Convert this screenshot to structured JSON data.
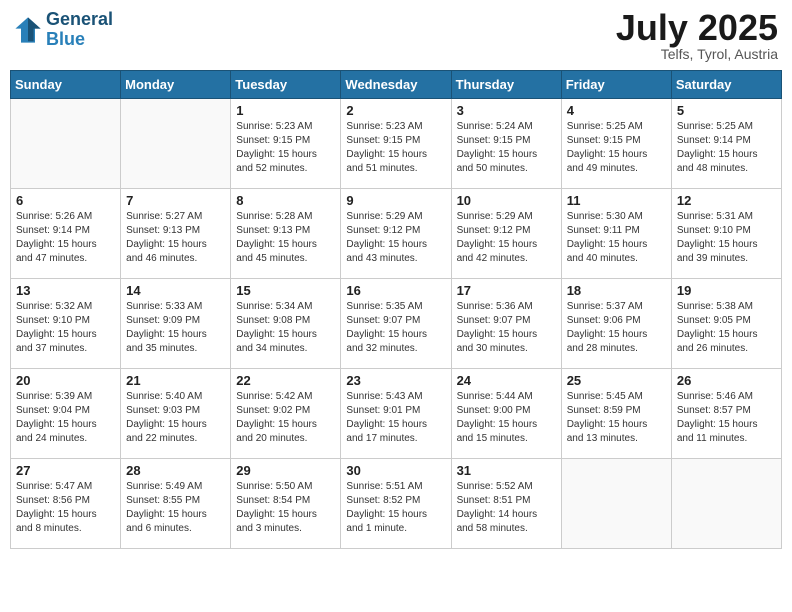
{
  "header": {
    "logo_line1": "General",
    "logo_line2": "Blue",
    "month": "July 2025",
    "location": "Telfs, Tyrol, Austria"
  },
  "days_of_week": [
    "Sunday",
    "Monday",
    "Tuesday",
    "Wednesday",
    "Thursday",
    "Friday",
    "Saturday"
  ],
  "weeks": [
    [
      {
        "day": "",
        "sunrise": "",
        "sunset": "",
        "daylight": ""
      },
      {
        "day": "",
        "sunrise": "",
        "sunset": "",
        "daylight": ""
      },
      {
        "day": "1",
        "sunrise": "Sunrise: 5:23 AM",
        "sunset": "Sunset: 9:15 PM",
        "daylight": "Daylight: 15 hours and 52 minutes."
      },
      {
        "day": "2",
        "sunrise": "Sunrise: 5:23 AM",
        "sunset": "Sunset: 9:15 PM",
        "daylight": "Daylight: 15 hours and 51 minutes."
      },
      {
        "day": "3",
        "sunrise": "Sunrise: 5:24 AM",
        "sunset": "Sunset: 9:15 PM",
        "daylight": "Daylight: 15 hours and 50 minutes."
      },
      {
        "day": "4",
        "sunrise": "Sunrise: 5:25 AM",
        "sunset": "Sunset: 9:15 PM",
        "daylight": "Daylight: 15 hours and 49 minutes."
      },
      {
        "day": "5",
        "sunrise": "Sunrise: 5:25 AM",
        "sunset": "Sunset: 9:14 PM",
        "daylight": "Daylight: 15 hours and 48 minutes."
      }
    ],
    [
      {
        "day": "6",
        "sunrise": "Sunrise: 5:26 AM",
        "sunset": "Sunset: 9:14 PM",
        "daylight": "Daylight: 15 hours and 47 minutes."
      },
      {
        "day": "7",
        "sunrise": "Sunrise: 5:27 AM",
        "sunset": "Sunset: 9:13 PM",
        "daylight": "Daylight: 15 hours and 46 minutes."
      },
      {
        "day": "8",
        "sunrise": "Sunrise: 5:28 AM",
        "sunset": "Sunset: 9:13 PM",
        "daylight": "Daylight: 15 hours and 45 minutes."
      },
      {
        "day": "9",
        "sunrise": "Sunrise: 5:29 AM",
        "sunset": "Sunset: 9:12 PM",
        "daylight": "Daylight: 15 hours and 43 minutes."
      },
      {
        "day": "10",
        "sunrise": "Sunrise: 5:29 AM",
        "sunset": "Sunset: 9:12 PM",
        "daylight": "Daylight: 15 hours and 42 minutes."
      },
      {
        "day": "11",
        "sunrise": "Sunrise: 5:30 AM",
        "sunset": "Sunset: 9:11 PM",
        "daylight": "Daylight: 15 hours and 40 minutes."
      },
      {
        "day": "12",
        "sunrise": "Sunrise: 5:31 AM",
        "sunset": "Sunset: 9:10 PM",
        "daylight": "Daylight: 15 hours and 39 minutes."
      }
    ],
    [
      {
        "day": "13",
        "sunrise": "Sunrise: 5:32 AM",
        "sunset": "Sunset: 9:10 PM",
        "daylight": "Daylight: 15 hours and 37 minutes."
      },
      {
        "day": "14",
        "sunrise": "Sunrise: 5:33 AM",
        "sunset": "Sunset: 9:09 PM",
        "daylight": "Daylight: 15 hours and 35 minutes."
      },
      {
        "day": "15",
        "sunrise": "Sunrise: 5:34 AM",
        "sunset": "Sunset: 9:08 PM",
        "daylight": "Daylight: 15 hours and 34 minutes."
      },
      {
        "day": "16",
        "sunrise": "Sunrise: 5:35 AM",
        "sunset": "Sunset: 9:07 PM",
        "daylight": "Daylight: 15 hours and 32 minutes."
      },
      {
        "day": "17",
        "sunrise": "Sunrise: 5:36 AM",
        "sunset": "Sunset: 9:07 PM",
        "daylight": "Daylight: 15 hours and 30 minutes."
      },
      {
        "day": "18",
        "sunrise": "Sunrise: 5:37 AM",
        "sunset": "Sunset: 9:06 PM",
        "daylight": "Daylight: 15 hours and 28 minutes."
      },
      {
        "day": "19",
        "sunrise": "Sunrise: 5:38 AM",
        "sunset": "Sunset: 9:05 PM",
        "daylight": "Daylight: 15 hours and 26 minutes."
      }
    ],
    [
      {
        "day": "20",
        "sunrise": "Sunrise: 5:39 AM",
        "sunset": "Sunset: 9:04 PM",
        "daylight": "Daylight: 15 hours and 24 minutes."
      },
      {
        "day": "21",
        "sunrise": "Sunrise: 5:40 AM",
        "sunset": "Sunset: 9:03 PM",
        "daylight": "Daylight: 15 hours and 22 minutes."
      },
      {
        "day": "22",
        "sunrise": "Sunrise: 5:42 AM",
        "sunset": "Sunset: 9:02 PM",
        "daylight": "Daylight: 15 hours and 20 minutes."
      },
      {
        "day": "23",
        "sunrise": "Sunrise: 5:43 AM",
        "sunset": "Sunset: 9:01 PM",
        "daylight": "Daylight: 15 hours and 17 minutes."
      },
      {
        "day": "24",
        "sunrise": "Sunrise: 5:44 AM",
        "sunset": "Sunset: 9:00 PM",
        "daylight": "Daylight: 15 hours and 15 minutes."
      },
      {
        "day": "25",
        "sunrise": "Sunrise: 5:45 AM",
        "sunset": "Sunset: 8:59 PM",
        "daylight": "Daylight: 15 hours and 13 minutes."
      },
      {
        "day": "26",
        "sunrise": "Sunrise: 5:46 AM",
        "sunset": "Sunset: 8:57 PM",
        "daylight": "Daylight: 15 hours and 11 minutes."
      }
    ],
    [
      {
        "day": "27",
        "sunrise": "Sunrise: 5:47 AM",
        "sunset": "Sunset: 8:56 PM",
        "daylight": "Daylight: 15 hours and 8 minutes."
      },
      {
        "day": "28",
        "sunrise": "Sunrise: 5:49 AM",
        "sunset": "Sunset: 8:55 PM",
        "daylight": "Daylight: 15 hours and 6 minutes."
      },
      {
        "day": "29",
        "sunrise": "Sunrise: 5:50 AM",
        "sunset": "Sunset: 8:54 PM",
        "daylight": "Daylight: 15 hours and 3 minutes."
      },
      {
        "day": "30",
        "sunrise": "Sunrise: 5:51 AM",
        "sunset": "Sunset: 8:52 PM",
        "daylight": "Daylight: 15 hours and 1 minute."
      },
      {
        "day": "31",
        "sunrise": "Sunrise: 5:52 AM",
        "sunset": "Sunset: 8:51 PM",
        "daylight": "Daylight: 14 hours and 58 minutes."
      },
      {
        "day": "",
        "sunrise": "",
        "sunset": "",
        "daylight": ""
      },
      {
        "day": "",
        "sunrise": "",
        "sunset": "",
        "daylight": ""
      }
    ]
  ]
}
